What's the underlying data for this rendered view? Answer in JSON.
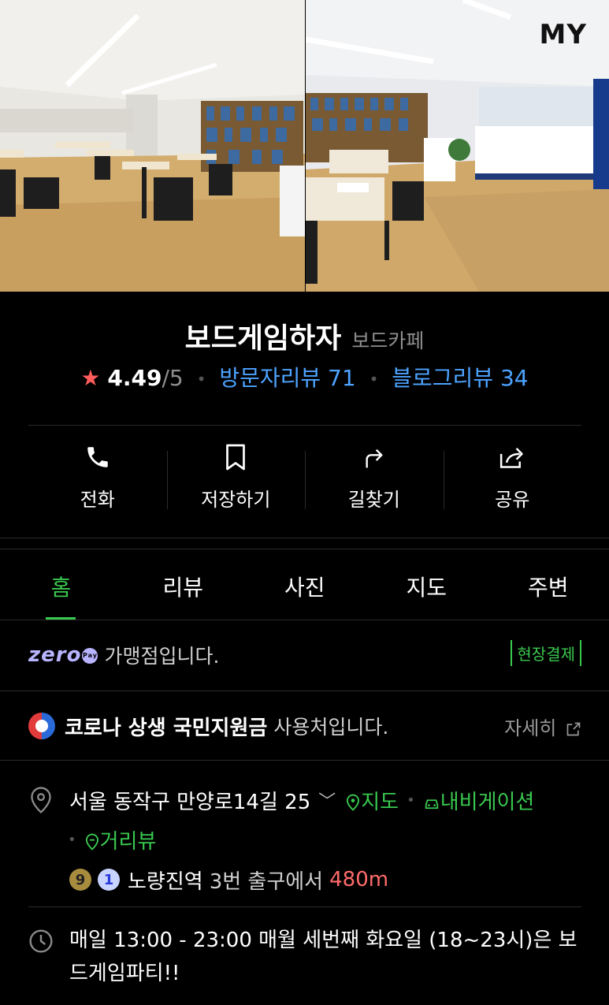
{
  "top_overlay": {
    "my_label": "MY"
  },
  "place": {
    "name": "보드게임하자",
    "category": "보드카페",
    "rating": "4.49",
    "rating_max": "/5",
    "visitor_reviews": "방문자리뷰 71",
    "blog_reviews": "블로그리뷰 34"
  },
  "actions": [
    {
      "label": "전화",
      "icon": "phone-icon"
    },
    {
      "label": "저장하기",
      "icon": "bookmark-icon"
    },
    {
      "label": "길찾기",
      "icon": "directions-icon"
    },
    {
      "label": "공유",
      "icon": "share-icon"
    }
  ],
  "tabs": [
    {
      "label": "홈",
      "active": true
    },
    {
      "label": "리뷰"
    },
    {
      "label": "사진"
    },
    {
      "label": "지도"
    },
    {
      "label": "주변"
    }
  ],
  "zero_pay": {
    "logo": "zero",
    "pay_mark": "Pay",
    "text": "가맹점입니다.",
    "badge": "현장결제"
  },
  "corona": {
    "strong": "코로나 상생 국민지원금",
    "rest": "사용처입니다.",
    "detail": "자세히"
  },
  "address": {
    "text": "서울 동작구 만양로14길 25",
    "map_link": "지도",
    "navigation_link": "내비게이션",
    "street_view_link": "거리뷰",
    "subway": {
      "line9": "9",
      "line1": "1",
      "station": "노량진역",
      "exit": "3번 출구에서",
      "distance": "480m"
    }
  },
  "hours": {
    "text": "매일 13:00 - 23:00 매월 세번째 화요일 (18~23시)은 보드게임파티!!"
  },
  "colors": {
    "accent_green": "#39c94f",
    "link_blue": "#4da3ff",
    "star_red": "#ff5c5c",
    "distance_red": "#ff6b6b",
    "background": "#000000"
  }
}
